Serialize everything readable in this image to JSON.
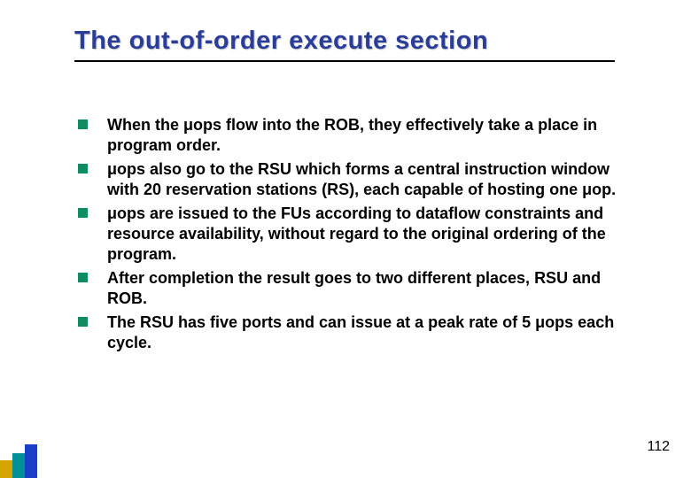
{
  "title": "The out-of-order execute section",
  "bullets": [
    "When the μops flow into the ROB, they effectively take a place in program order.",
    "μops also go to the RSU which forms a central instruction window with 20 reservation stations (RS), each capable of hosting one μop.",
    "μops are issued to the FUs according to dataflow constraints and resource availability, without regard to the original ordering of the program.",
    "After completion the result goes to two different places, RSU and ROB.",
    "The RSU has five ports and can issue at a peak rate of 5 μops each cycle."
  ],
  "page_number": "112"
}
